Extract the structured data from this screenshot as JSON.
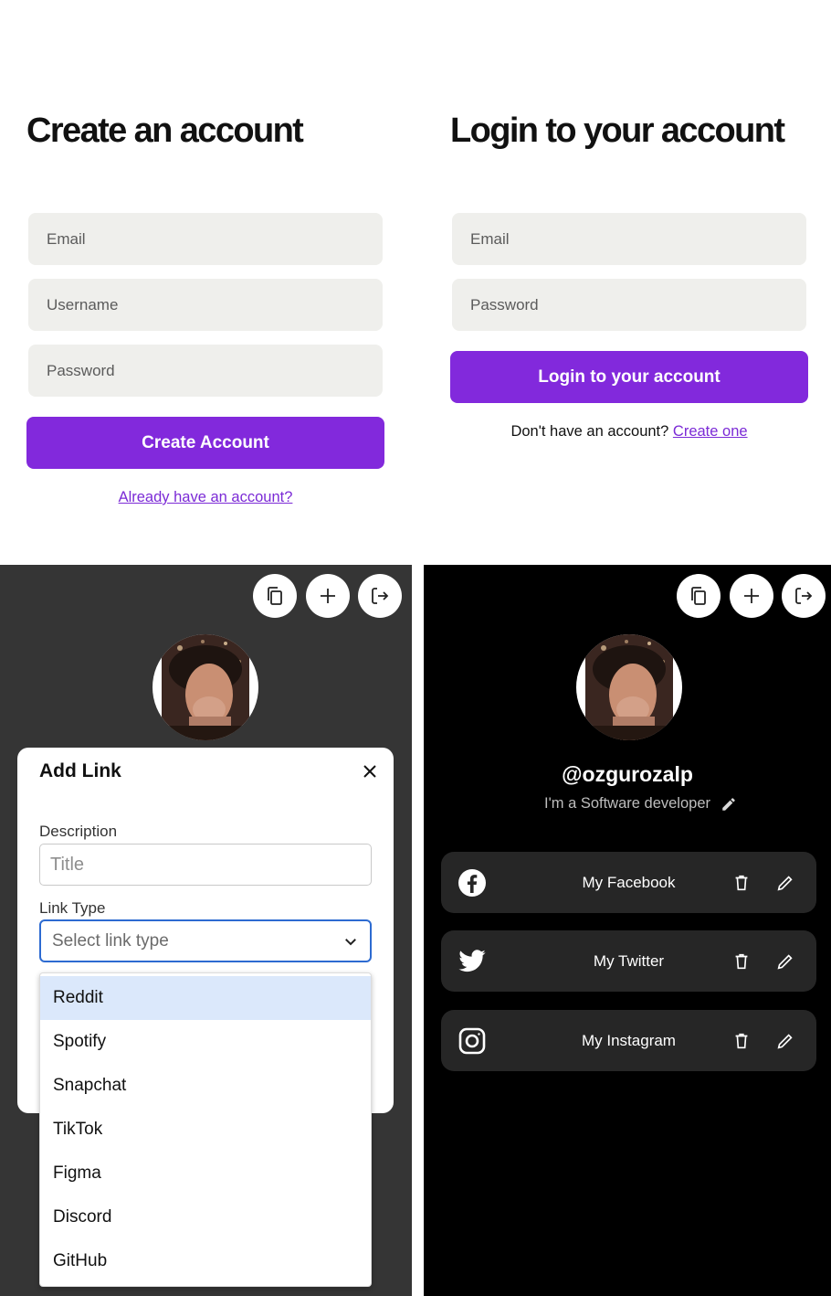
{
  "signup": {
    "title": "Create an account",
    "email_placeholder": "Email",
    "username_placeholder": "Username",
    "password_placeholder": "Password",
    "submit_label": "Create Account",
    "login_link": "Already have an account?"
  },
  "login": {
    "title": "Login to your account",
    "email_placeholder": "Email",
    "password_placeholder": "Password",
    "submit_label": "Login to your account",
    "prompt_text": "Don't have an account?",
    "signup_link": "Create one"
  },
  "toolbar_icons": [
    "copy-icon",
    "plus-icon",
    "logout-icon"
  ],
  "add_link_modal": {
    "title": "Add Link",
    "description_label": "Description",
    "title_placeholder": "Title",
    "link_type_label": "Link Type",
    "select_placeholder": "Select link type",
    "options": [
      "Reddit",
      "Spotify",
      "Snapchat",
      "TikTok",
      "Figma",
      "Discord",
      "GitHub"
    ],
    "highlighted_option": "Reddit"
  },
  "profile": {
    "handle": "@ozgurozalp",
    "bio": "I'm a Software developer",
    "links": [
      {
        "label": "My Facebook",
        "icon": "facebook-icon"
      },
      {
        "label": "My Twitter",
        "icon": "twitter-icon"
      },
      {
        "label": "My Instagram",
        "icon": "instagram-icon"
      }
    ]
  },
  "colors": {
    "accent": "#8229dc",
    "link": "#7b2ad6",
    "gray_panel": "#353535",
    "card": "#262626",
    "select_focus": "#2d6bd1"
  }
}
